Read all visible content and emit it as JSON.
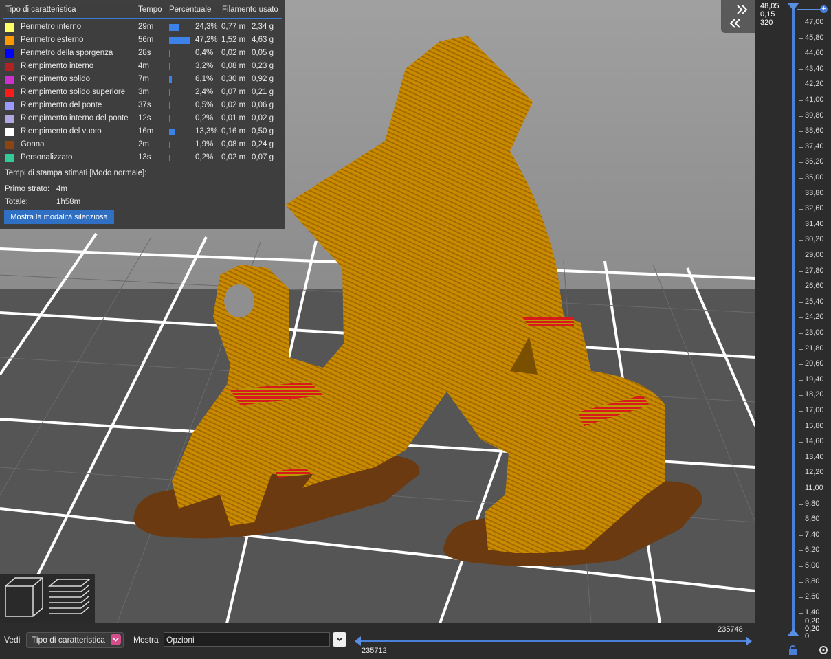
{
  "legend": {
    "headers": {
      "type": "Tipo di caratteristica",
      "time": "Tempo",
      "percent": "Percentuale",
      "filament": "Filamento usato"
    },
    "rows": [
      {
        "name": "Perimetro interno",
        "time": "29m",
        "percent": "24,3%",
        "length": "0,77 m",
        "weight": "2,34 g",
        "color": "#ffff66",
        "fraction": 0.243
      },
      {
        "name": "Perimetro esterno",
        "time": "56m",
        "percent": "47,2%",
        "length": "1,52 m",
        "weight": "4,63 g",
        "color": "#ff9900",
        "fraction": 0.472
      },
      {
        "name": "Perimetro della sporgenza",
        "time": "28s",
        "percent": "0,4%",
        "length": "0,02 m",
        "weight": "0,05 g",
        "color": "#0000ff",
        "fraction": 0.004
      },
      {
        "name": "Riempimento interno",
        "time": "4m",
        "percent": "3,2%",
        "length": "0,08 m",
        "weight": "0,23 g",
        "color": "#b22222",
        "fraction": 0.032
      },
      {
        "name": "Riempimento solido",
        "time": "7m",
        "percent": "6,1%",
        "length": "0,30 m",
        "weight": "0,92 g",
        "color": "#cc33cc",
        "fraction": 0.061
      },
      {
        "name": "Riempimento solido superiore",
        "time": "3m",
        "percent": "2,4%",
        "length": "0,07 m",
        "weight": "0,21 g",
        "color": "#ff1a1a",
        "fraction": 0.024
      },
      {
        "name": "Riempimento del ponte",
        "time": "37s",
        "percent": "0,5%",
        "length": "0,02 m",
        "weight": "0,06 g",
        "color": "#9999ff",
        "fraction": 0.005
      },
      {
        "name": "Riempimento interno del ponte",
        "time": "12s",
        "percent": "0,2%",
        "length": "0,01 m",
        "weight": "0,02 g",
        "color": "#b0a8e0",
        "fraction": 0.002
      },
      {
        "name": "Riempimento del vuoto",
        "time": "16m",
        "percent": "13,3%",
        "length": "0,16 m",
        "weight": "0,50 g",
        "color": "#ffffff",
        "fraction": 0.133
      },
      {
        "name": "Gonna",
        "time": "2m",
        "percent": "1,9%",
        "length": "0,08 m",
        "weight": "0,24 g",
        "color": "#8b4513",
        "fraction": 0.019
      },
      {
        "name": "Personalizzato",
        "time": "13s",
        "percent": "0,2%",
        "length": "0,02 m",
        "weight": "0,07 g",
        "color": "#33cc99",
        "fraction": 0.002
      }
    ],
    "estimated_title": "Tempi di stampa stimati [Modo normale]:",
    "first_layer_label": "Primo strato:",
    "first_layer_value": "4m",
    "total_label": "Totale:",
    "total_value": "1h58m",
    "silent_button": "Mostra la modalità silenziosa"
  },
  "vertical_slider": {
    "top_values": [
      "48,05",
      "0,15",
      "320"
    ],
    "ticks": [
      "47,00",
      "45,80",
      "44,60",
      "43,40",
      "42,20",
      "41,00",
      "39,80",
      "38,60",
      "37,40",
      "36,20",
      "35,00",
      "33,80",
      "32,60",
      "31,40",
      "30,20",
      "29,00",
      "27,80",
      "26,60",
      "25,40",
      "24,20",
      "23,00",
      "21,80",
      "20,60",
      "19,40",
      "18,20",
      "17,00",
      "15,80",
      "14,60",
      "13,40",
      "12,20",
      "11,00",
      "9,80",
      "8,60",
      "7,40",
      "6,20",
      "5,00",
      "3,80",
      "2,60",
      "1,40"
    ],
    "bottom_values": [
      "0,20",
      "0,20",
      "0"
    ]
  },
  "bottom": {
    "view_label": "Vedi",
    "view_value": "Tipo di caratteristica",
    "show_label": "Mostra",
    "show_value": "Opzioni",
    "h_slider_upper": "235748",
    "h_slider_lower": "235712"
  },
  "icons": {
    "collapse": "chevron-double-right-left-icon",
    "view_3d": "cube-icon",
    "view_layers": "layers-icon",
    "lock": "lock-icon",
    "settings": "gear-icon",
    "add": "plus-icon",
    "dropdown": "chevron-down-icon"
  }
}
